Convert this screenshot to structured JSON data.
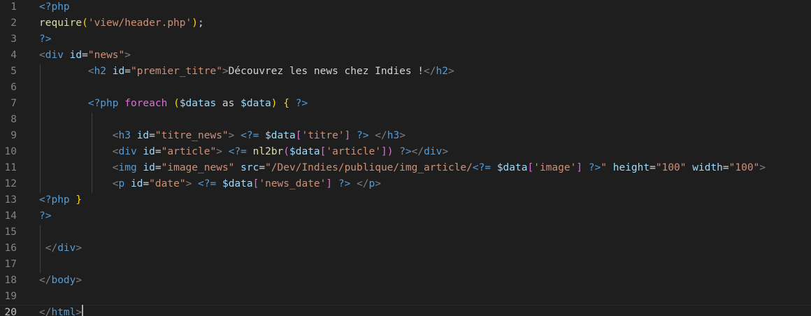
{
  "editor": {
    "current_line": 20,
    "colors": {
      "background": "#1e1e1e",
      "keyword": "#569cd6",
      "attribute": "#9cdcfe",
      "string": "#ce9178",
      "function": "#dcdcaa",
      "text": "#d4d4d4",
      "bracket": "#808080",
      "brace_gold": "#ffd700",
      "brace_pink": "#da70d6"
    },
    "lines": [
      {
        "n": "1",
        "tokens": [
          {
            "t": "<?php",
            "c": "t-blue"
          }
        ]
      },
      {
        "n": "2",
        "tokens": [
          {
            "t": "require",
            "c": "t-fn"
          },
          {
            "t": "(",
            "c": "t-gold"
          },
          {
            "t": "'view/header.php'",
            "c": "t-str"
          },
          {
            "t": ")",
            "c": "t-gold"
          },
          {
            "t": ";",
            "c": "t-text"
          }
        ]
      },
      {
        "n": "3",
        "tokens": [
          {
            "t": "?>",
            "c": "t-blue"
          }
        ]
      },
      {
        "n": "4",
        "tokens": [
          {
            "t": "<",
            "c": "t-grey"
          },
          {
            "t": "div",
            "c": "t-blue"
          },
          {
            "t": " ",
            "c": "t-text"
          },
          {
            "t": "id",
            "c": "t-lblue"
          },
          {
            "t": "=",
            "c": "t-text"
          },
          {
            "t": "\"news\"",
            "c": "t-str"
          },
          {
            "t": ">",
            "c": "t-grey"
          }
        ]
      },
      {
        "n": "5",
        "tokens": [
          {
            "t": "        ",
            "c": "t-text"
          },
          {
            "t": "<",
            "c": "t-grey"
          },
          {
            "t": "h2",
            "c": "t-blue"
          },
          {
            "t": " ",
            "c": "t-text"
          },
          {
            "t": "id",
            "c": "t-lblue"
          },
          {
            "t": "=",
            "c": "t-text"
          },
          {
            "t": "\"premier_titre\"",
            "c": "t-str"
          },
          {
            "t": ">",
            "c": "t-grey"
          },
          {
            "t": "Découvrez les news chez Indies !",
            "c": "t-text"
          },
          {
            "t": "</",
            "c": "t-grey"
          },
          {
            "t": "h2",
            "c": "t-blue"
          },
          {
            "t": ">",
            "c": "t-grey"
          }
        ]
      },
      {
        "n": "6",
        "tokens": []
      },
      {
        "n": "7",
        "tokens": [
          {
            "t": "        ",
            "c": "t-text"
          },
          {
            "t": "<?php",
            "c": "t-blue"
          },
          {
            "t": " ",
            "c": "t-text"
          },
          {
            "t": "foreach",
            "c": "t-pink"
          },
          {
            "t": " ",
            "c": "t-text"
          },
          {
            "t": "(",
            "c": "t-gold"
          },
          {
            "t": "$datas",
            "c": "t-lblue"
          },
          {
            "t": " as ",
            "c": "t-text"
          },
          {
            "t": "$data",
            "c": "t-lblue"
          },
          {
            "t": ")",
            "c": "t-gold"
          },
          {
            "t": " ",
            "c": "t-text"
          },
          {
            "t": "{",
            "c": "t-gold"
          },
          {
            "t": " ",
            "c": "t-text"
          },
          {
            "t": "?>",
            "c": "t-blue"
          }
        ]
      },
      {
        "n": "8",
        "tokens": []
      },
      {
        "n": "9",
        "tokens": [
          {
            "t": "            ",
            "c": "t-text"
          },
          {
            "t": "<",
            "c": "t-grey"
          },
          {
            "t": "h3",
            "c": "t-blue"
          },
          {
            "t": " ",
            "c": "t-text"
          },
          {
            "t": "id",
            "c": "t-lblue"
          },
          {
            "t": "=",
            "c": "t-text"
          },
          {
            "t": "\"titre_news\"",
            "c": "t-str"
          },
          {
            "t": ">",
            "c": "t-grey"
          },
          {
            "t": " ",
            "c": "t-text"
          },
          {
            "t": "<?=",
            "c": "t-blue"
          },
          {
            "t": " ",
            "c": "t-text"
          },
          {
            "t": "$data",
            "c": "t-lblue"
          },
          {
            "t": "[",
            "c": "t-pink"
          },
          {
            "t": "'titre'",
            "c": "t-str"
          },
          {
            "t": "]",
            "c": "t-pink"
          },
          {
            "t": " ",
            "c": "t-text"
          },
          {
            "t": "?>",
            "c": "t-blue"
          },
          {
            "t": " ",
            "c": "t-text"
          },
          {
            "t": "</",
            "c": "t-grey"
          },
          {
            "t": "h3",
            "c": "t-blue"
          },
          {
            "t": ">",
            "c": "t-grey"
          }
        ]
      },
      {
        "n": "10",
        "tokens": [
          {
            "t": "            ",
            "c": "t-text"
          },
          {
            "t": "<",
            "c": "t-grey"
          },
          {
            "t": "div",
            "c": "t-blue"
          },
          {
            "t": " ",
            "c": "t-text"
          },
          {
            "t": "id",
            "c": "t-lblue"
          },
          {
            "t": "=",
            "c": "t-text"
          },
          {
            "t": "\"article\"",
            "c": "t-str"
          },
          {
            "t": ">",
            "c": "t-grey"
          },
          {
            "t": " ",
            "c": "t-text"
          },
          {
            "t": "<?=",
            "c": "t-blue"
          },
          {
            "t": " ",
            "c": "t-text"
          },
          {
            "t": "nl2br",
            "c": "t-fn"
          },
          {
            "t": "(",
            "c": "t-pink"
          },
          {
            "t": "$data",
            "c": "t-lblue"
          },
          {
            "t": "[",
            "c": "t-pink"
          },
          {
            "t": "'article'",
            "c": "t-str"
          },
          {
            "t": "]",
            "c": "t-pink"
          },
          {
            "t": ")",
            "c": "t-pink"
          },
          {
            "t": " ",
            "c": "t-text"
          },
          {
            "t": "?>",
            "c": "t-blue"
          },
          {
            "t": "</",
            "c": "t-grey"
          },
          {
            "t": "div",
            "c": "t-blue"
          },
          {
            "t": ">",
            "c": "t-grey"
          }
        ]
      },
      {
        "n": "11",
        "tokens": [
          {
            "t": "            ",
            "c": "t-text"
          },
          {
            "t": "<",
            "c": "t-grey"
          },
          {
            "t": "img",
            "c": "t-blue"
          },
          {
            "t": " ",
            "c": "t-text"
          },
          {
            "t": "id",
            "c": "t-lblue"
          },
          {
            "t": "=",
            "c": "t-text"
          },
          {
            "t": "\"image_news\"",
            "c": "t-str"
          },
          {
            "t": " ",
            "c": "t-text"
          },
          {
            "t": "src",
            "c": "t-lblue"
          },
          {
            "t": "=",
            "c": "t-text"
          },
          {
            "t": "\"/Dev/Indies/publique/img_article/",
            "c": "t-str"
          },
          {
            "t": "<?=",
            "c": "t-blue"
          },
          {
            "t": " ",
            "c": "t-text"
          },
          {
            "t": "$data",
            "c": "t-lblue"
          },
          {
            "t": "[",
            "c": "t-pink"
          },
          {
            "t": "'image'",
            "c": "t-str"
          },
          {
            "t": "]",
            "c": "t-pink"
          },
          {
            "t": " ",
            "c": "t-text"
          },
          {
            "t": "?>",
            "c": "t-blue"
          },
          {
            "t": "\"",
            "c": "t-str"
          },
          {
            "t": " ",
            "c": "t-text"
          },
          {
            "t": "height",
            "c": "t-lblue"
          },
          {
            "t": "=",
            "c": "t-text"
          },
          {
            "t": "\"100\"",
            "c": "t-str"
          },
          {
            "t": " ",
            "c": "t-text"
          },
          {
            "t": "width",
            "c": "t-lblue"
          },
          {
            "t": "=",
            "c": "t-text"
          },
          {
            "t": "\"100\"",
            "c": "t-str"
          },
          {
            "t": ">",
            "c": "t-grey"
          }
        ]
      },
      {
        "n": "12",
        "tokens": [
          {
            "t": "            ",
            "c": "t-text"
          },
          {
            "t": "<",
            "c": "t-grey"
          },
          {
            "t": "p",
            "c": "t-blue"
          },
          {
            "t": " ",
            "c": "t-text"
          },
          {
            "t": "id",
            "c": "t-lblue"
          },
          {
            "t": "=",
            "c": "t-text"
          },
          {
            "t": "\"date\"",
            "c": "t-str"
          },
          {
            "t": ">",
            "c": "t-grey"
          },
          {
            "t": " ",
            "c": "t-text"
          },
          {
            "t": "<?=",
            "c": "t-blue"
          },
          {
            "t": " ",
            "c": "t-text"
          },
          {
            "t": "$data",
            "c": "t-lblue"
          },
          {
            "t": "[",
            "c": "t-pink"
          },
          {
            "t": "'news_date'",
            "c": "t-str"
          },
          {
            "t": "]",
            "c": "t-pink"
          },
          {
            "t": " ",
            "c": "t-text"
          },
          {
            "t": "?>",
            "c": "t-blue"
          },
          {
            "t": " ",
            "c": "t-text"
          },
          {
            "t": "</",
            "c": "t-grey"
          },
          {
            "t": "p",
            "c": "t-blue"
          },
          {
            "t": ">",
            "c": "t-grey"
          }
        ]
      },
      {
        "n": "13",
        "tokens": [
          {
            "t": "<?php",
            "c": "t-blue"
          },
          {
            "t": " ",
            "c": "t-text"
          },
          {
            "t": "}",
            "c": "t-gold"
          }
        ]
      },
      {
        "n": "14",
        "tokens": [
          {
            "t": "?>",
            "c": "t-blue"
          }
        ]
      },
      {
        "n": "15",
        "tokens": []
      },
      {
        "n": "16",
        "tokens": [
          {
            "t": " ",
            "c": "t-text"
          },
          {
            "t": "</",
            "c": "t-grey"
          },
          {
            "t": "div",
            "c": "t-blue"
          },
          {
            "t": ">",
            "c": "t-grey"
          }
        ]
      },
      {
        "n": "17",
        "tokens": []
      },
      {
        "n": "18",
        "tokens": [
          {
            "t": "</",
            "c": "t-grey"
          },
          {
            "t": "body",
            "c": "t-blue"
          },
          {
            "t": ">",
            "c": "t-grey"
          }
        ]
      },
      {
        "n": "19",
        "tokens": []
      },
      {
        "n": "20",
        "tokens": [
          {
            "t": "</",
            "c": "t-grey"
          },
          {
            "t": "html",
            "c": "t-blue"
          },
          {
            "t": ">",
            "c": "t-grey"
          }
        ]
      }
    ]
  }
}
